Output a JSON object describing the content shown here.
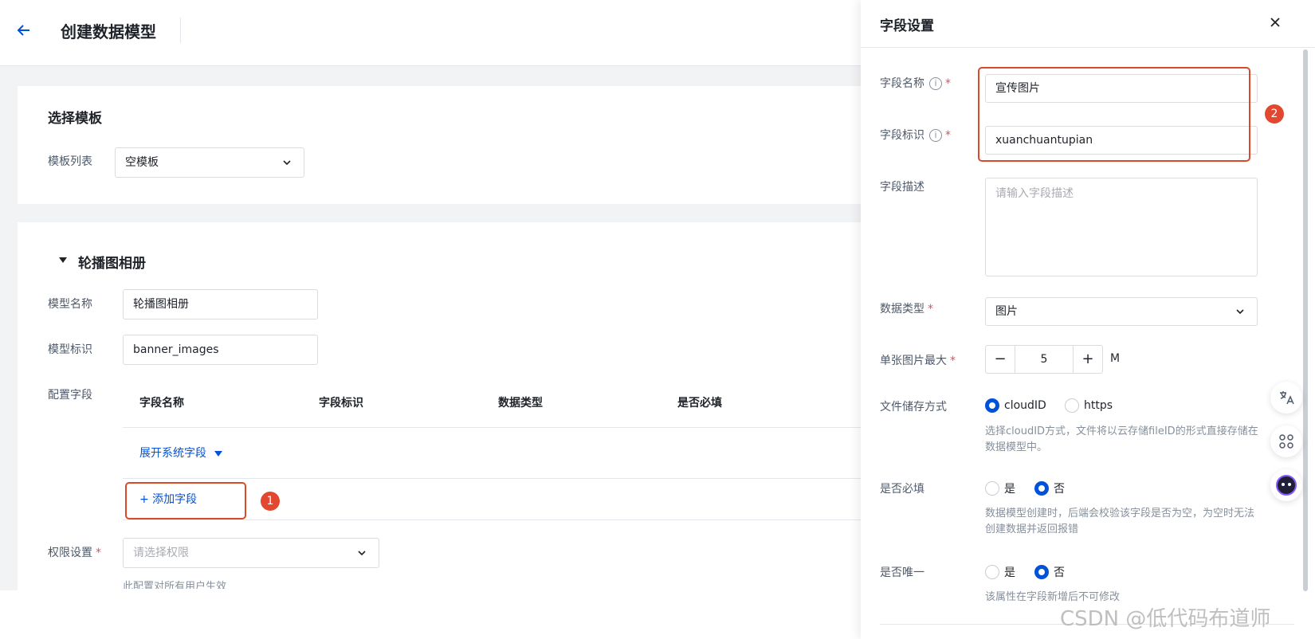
{
  "header": {
    "title": "创建数据模型"
  },
  "template_section": {
    "title": "选择模板",
    "list_label": "模板列表",
    "selected": "空模板"
  },
  "model_section": {
    "title": "轮播图相册",
    "name_label": "模型名称",
    "name_value": "轮播图相册",
    "key_label": "模型标识",
    "key_value": "banner_images",
    "fields_label": "配置字段",
    "columns": [
      "字段名称",
      "字段标识",
      "数据类型",
      "是否必填"
    ],
    "expand_link": "展开系统字段",
    "add_field": "+ 添加字段",
    "badge1": "1",
    "permission_label": "权限设置",
    "permission_placeholder": "请选择权限",
    "permission_hint": "此配置对所有用户生效"
  },
  "panel": {
    "title": "字段设置",
    "badge2": "2",
    "field_name_label": "字段名称",
    "field_name_value": "宣传图片",
    "field_key_label": "字段标识",
    "field_key_value": "xuanchuantupian",
    "desc_label": "字段描述",
    "desc_placeholder": "请输入字段描述",
    "type_label": "数据类型",
    "type_value": "图片",
    "max_label": "单张图片最大",
    "max_value": "5",
    "max_unit": "M",
    "storage_label": "文件储存方式",
    "storage_opt1": "cloudID",
    "storage_opt2": "https",
    "storage_desc": "选择cloudID方式，文件将以云存储fileID的形式直接存储在数据模型中。",
    "required_label": "是否必填",
    "yes": "是",
    "no": "否",
    "required_desc": "数据模型创建时，后端会校验该字段是否为空，为空时无法创建数据并返回报错",
    "unique_label": "是否唯一",
    "unique_desc": "该属性在字段新增后不可修改"
  },
  "watermark": "CSDN @低代码布道师",
  "colors": {
    "primary": "#0052d9",
    "highlight": "#d94a2b",
    "required": "#e34d59"
  }
}
